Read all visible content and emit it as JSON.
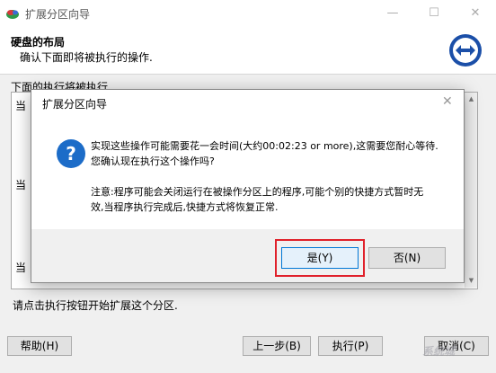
{
  "window": {
    "title": "扩展分区向导",
    "minimize": "—",
    "maximize": "☐",
    "close": "✕"
  },
  "header": {
    "title": "硬盘的布局",
    "subtitle": "确认下面即将被执行的操作."
  },
  "list": {
    "label": "下面的执行将被执行.",
    "visible_fragments": [
      "当",
      "当",
      "当"
    ]
  },
  "hint": "请点击执行按钮开始扩展这个分区.",
  "buttons": {
    "help": "帮助(H)",
    "back": "上一步(B)",
    "execute": "执行(P)",
    "cancel": "取消(C)"
  },
  "dialog": {
    "title": "扩展分区向导",
    "message_line1": "实现这些操作可能需要花一会时间(大约00:02:23 or more),这需要您耐心等待.",
    "message_line2": "您确认现在执行这个操作吗?",
    "note_line1": "注意:程序可能会关闭运行在被操作分区上的程序,可能个别的快捷方式暂时无",
    "note_line2": "效,当程序执行完成后,快捷方式将恢复正常.",
    "yes": "是(Y)",
    "no": "否(N)",
    "icon": "question-icon"
  },
  "colors": {
    "highlight_outline": "#e0202a",
    "question_icon": "#1c6cc8",
    "focus_border": "#0078d7"
  }
}
